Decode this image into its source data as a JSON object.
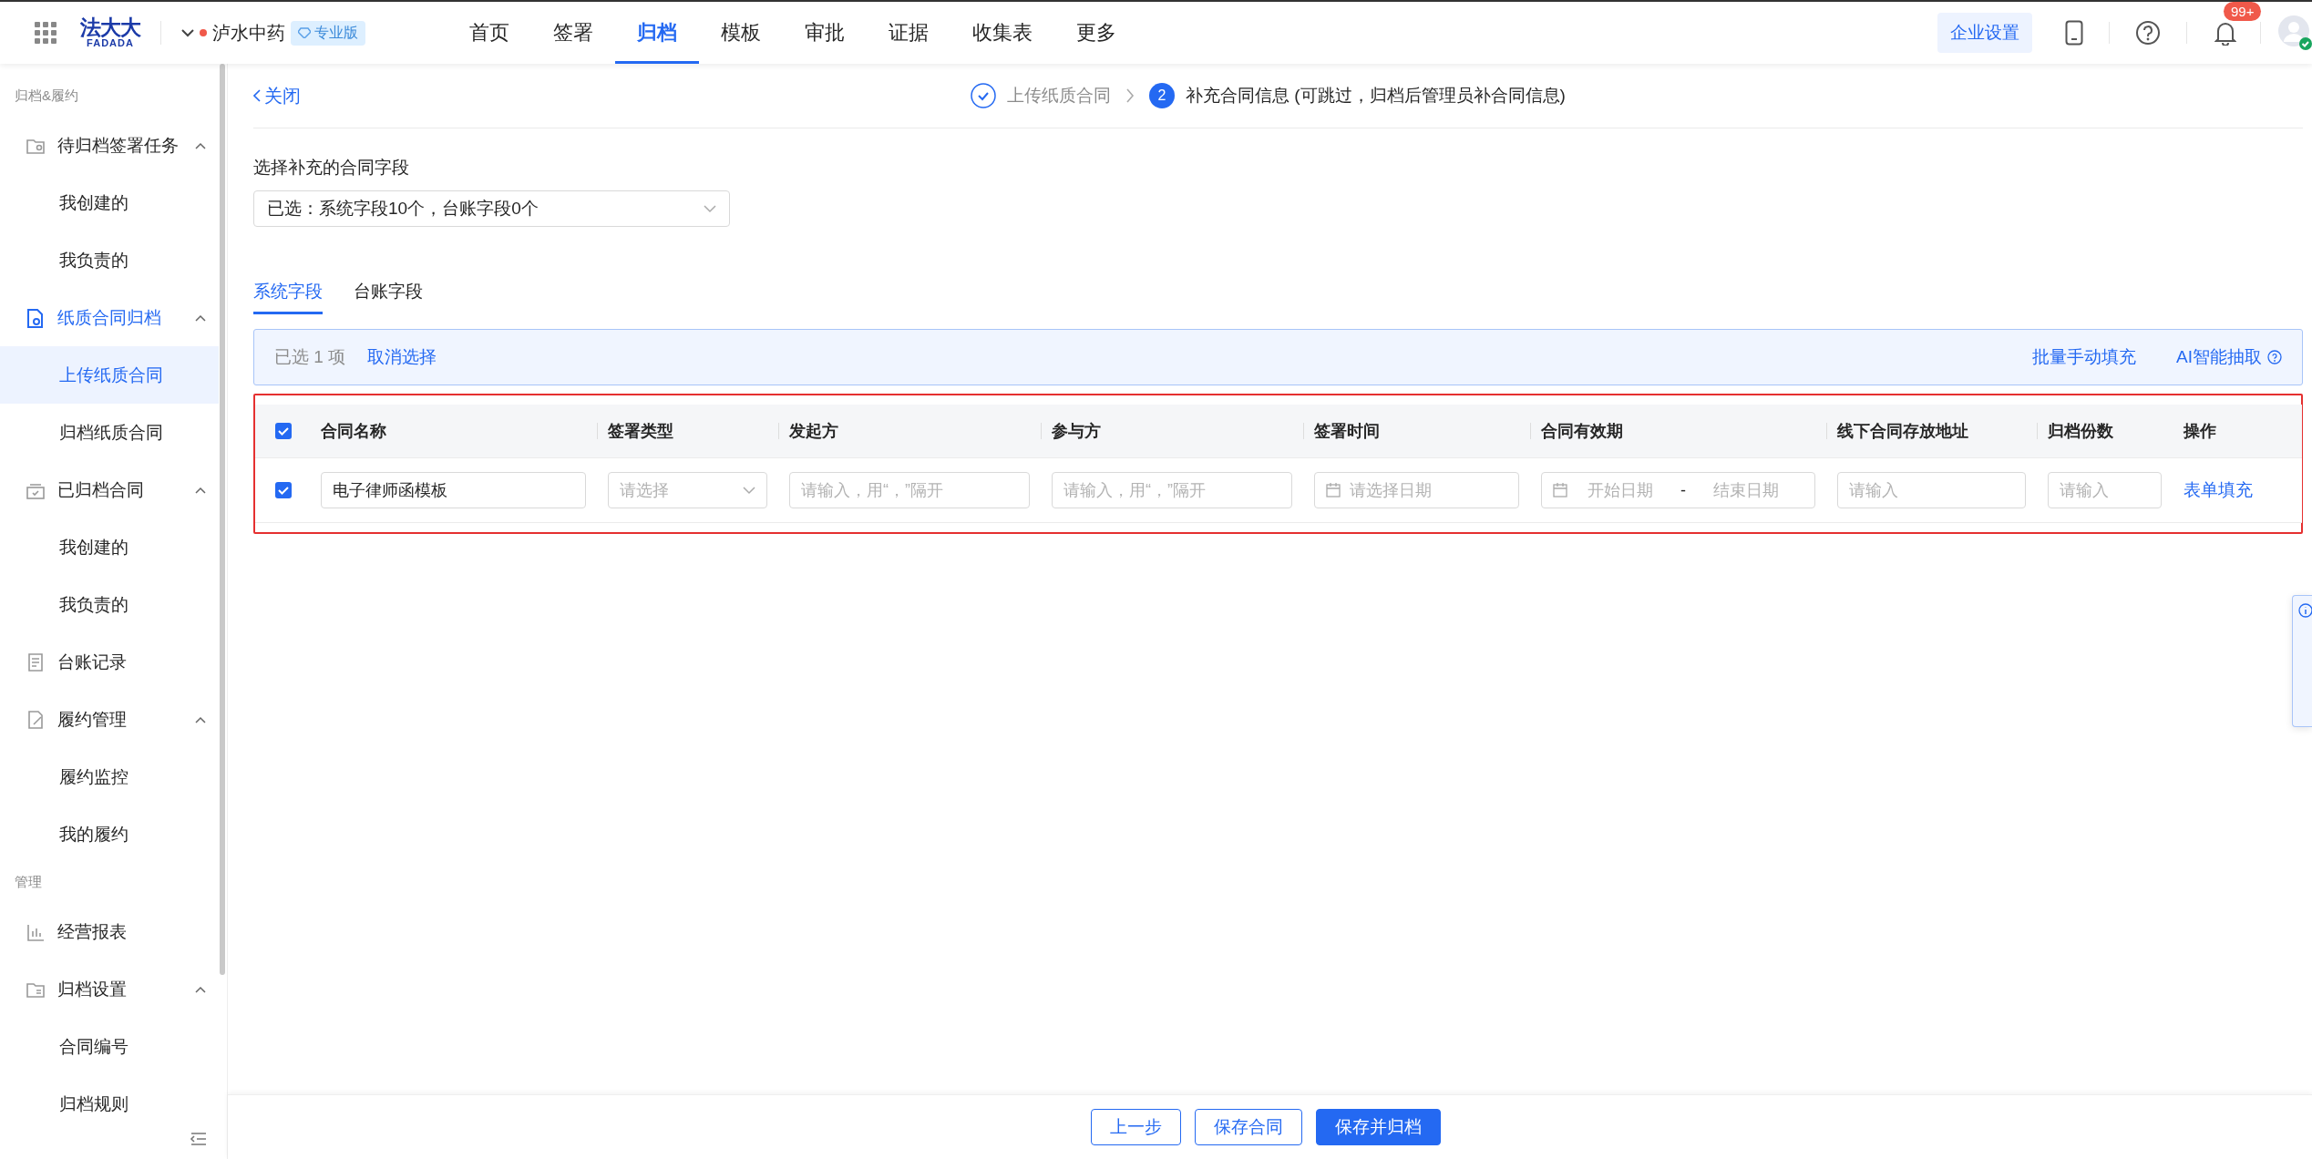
{
  "topbar": {
    "logo": {
      "text": "法大大",
      "subtext": "FADADA"
    },
    "org": {
      "name": "泸水中药",
      "badge": "专业版"
    },
    "nav": [
      {
        "label": "首页",
        "selected": false
      },
      {
        "label": "签署",
        "selected": false
      },
      {
        "label": "归档",
        "selected": true
      },
      {
        "label": "模板",
        "selected": false
      },
      {
        "label": "审批",
        "selected": false
      },
      {
        "label": "证据",
        "selected": false
      },
      {
        "label": "收集表",
        "selected": false
      },
      {
        "label": "更多",
        "selected": false
      }
    ],
    "settings_button": "企业设置",
    "notification_count": "99+"
  },
  "sidebar": {
    "sections": [
      {
        "title": "归档&履约",
        "items": [
          {
            "label": "待归档签署任务",
            "expanded": true,
            "selected": false,
            "children": [
              {
                "label": "我创建的",
                "selected": false
              },
              {
                "label": "我负责的",
                "selected": false
              }
            ]
          },
          {
            "label": "纸质合同归档",
            "expanded": true,
            "selected": false,
            "children": [
              {
                "label": "上传纸质合同",
                "selected": true
              },
              {
                "label": "归档纸质合同",
                "selected": false
              }
            ]
          },
          {
            "label": "已归档合同",
            "expanded": true,
            "selected": false,
            "children": [
              {
                "label": "我创建的",
                "selected": false
              },
              {
                "label": "我负责的",
                "selected": false
              }
            ]
          },
          {
            "label": "台账记录",
            "selected": false
          },
          {
            "label": "履约管理",
            "expanded": true,
            "selected": false,
            "children": [
              {
                "label": "履约监控",
                "selected": false
              },
              {
                "label": "我的履约",
                "selected": false
              }
            ]
          }
        ]
      },
      {
        "title": "管理",
        "items": [
          {
            "label": "经营报表",
            "selected": false
          },
          {
            "label": "归档设置",
            "expanded": true,
            "selected": false,
            "children": [
              {
                "label": "合同编号",
                "selected": false
              },
              {
                "label": "归档规则",
                "selected": false
              }
            ]
          }
        ]
      }
    ]
  },
  "header": {
    "close_link": "关闭",
    "steps": [
      {
        "label": "上传纸质合同",
        "completed": true
      },
      {
        "number": "2",
        "label": "补充合同信息 (可跳过，归档后管理员补合同信息)",
        "completed": false
      }
    ]
  },
  "field_picker": {
    "label": "选择补充的合同字段",
    "value": "已选：系统字段10个，台账字段0个"
  },
  "tabs": [
    {
      "label": "系统字段",
      "selected": true
    },
    {
      "label": "台账字段",
      "selected": false
    }
  ],
  "selection_bar": {
    "count": "已选 1 项",
    "clear_link": "取消选择",
    "actions": [
      "批量手动填充",
      "AI智能抽取"
    ]
  },
  "table": {
    "all_checked": true,
    "columns": [
      "合同名称",
      "签署类型",
      "发起方",
      "参与方",
      "签署时间",
      "合同有效期",
      "线下合同存放地址",
      "归档份数",
      "操作"
    ],
    "rows": [
      {
        "checked": true,
        "cells": [
          {
            "kind": "input",
            "value": "电子律师函模板"
          },
          {
            "kind": "select",
            "placeholder": "请选择"
          },
          {
            "kind": "input",
            "placeholder": "请输入，用“，”隔开"
          },
          {
            "kind": "input",
            "placeholder": "请输入，用“，”隔开"
          },
          {
            "kind": "date",
            "placeholder": "请选择日期"
          },
          {
            "kind": "range",
            "start_placeholder": "开始日期",
            "separator": "-",
            "end_placeholder": "结束日期"
          },
          {
            "kind": "input",
            "placeholder": "请输入"
          },
          {
            "kind": "input",
            "placeholder": "请输入"
          }
        ],
        "action": "表单填充"
      }
    ]
  },
  "footer": {
    "buttons": [
      {
        "label": "上一步",
        "kind": "outline"
      },
      {
        "label": "保存合同",
        "kind": "outline"
      },
      {
        "label": "保存并归档",
        "kind": "primary"
      }
    ]
  }
}
